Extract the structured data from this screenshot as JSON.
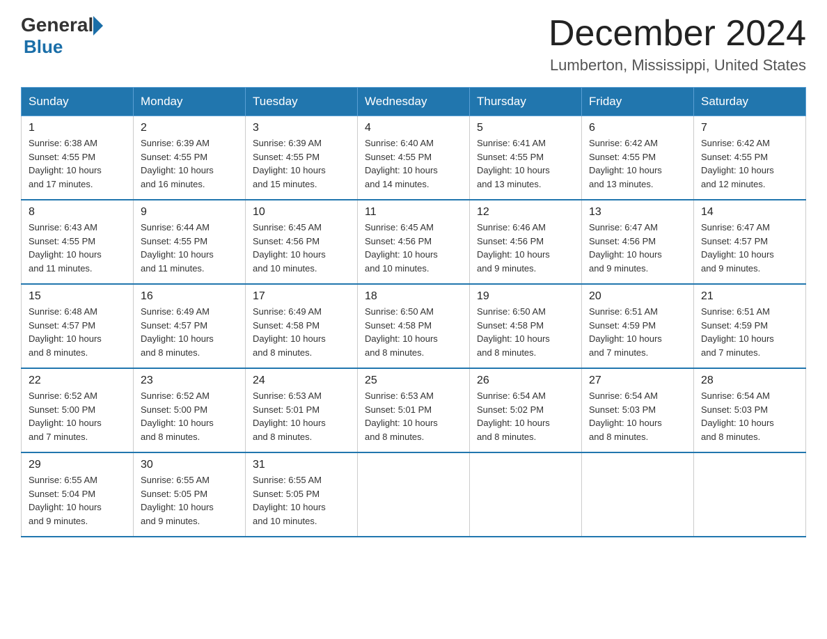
{
  "logo": {
    "general": "General",
    "blue": "Blue"
  },
  "title": "December 2024",
  "location": "Lumberton, Mississippi, United States",
  "days_of_week": [
    "Sunday",
    "Monday",
    "Tuesday",
    "Wednesday",
    "Thursday",
    "Friday",
    "Saturday"
  ],
  "weeks": [
    [
      {
        "day": "1",
        "sunrise": "6:38 AM",
        "sunset": "4:55 PM",
        "daylight": "10 hours and 17 minutes."
      },
      {
        "day": "2",
        "sunrise": "6:39 AM",
        "sunset": "4:55 PM",
        "daylight": "10 hours and 16 minutes."
      },
      {
        "day": "3",
        "sunrise": "6:39 AM",
        "sunset": "4:55 PM",
        "daylight": "10 hours and 15 minutes."
      },
      {
        "day": "4",
        "sunrise": "6:40 AM",
        "sunset": "4:55 PM",
        "daylight": "10 hours and 14 minutes."
      },
      {
        "day": "5",
        "sunrise": "6:41 AM",
        "sunset": "4:55 PM",
        "daylight": "10 hours and 13 minutes."
      },
      {
        "day": "6",
        "sunrise": "6:42 AM",
        "sunset": "4:55 PM",
        "daylight": "10 hours and 13 minutes."
      },
      {
        "day": "7",
        "sunrise": "6:42 AM",
        "sunset": "4:55 PM",
        "daylight": "10 hours and 12 minutes."
      }
    ],
    [
      {
        "day": "8",
        "sunrise": "6:43 AM",
        "sunset": "4:55 PM",
        "daylight": "10 hours and 11 minutes."
      },
      {
        "day": "9",
        "sunrise": "6:44 AM",
        "sunset": "4:55 PM",
        "daylight": "10 hours and 11 minutes."
      },
      {
        "day": "10",
        "sunrise": "6:45 AM",
        "sunset": "4:56 PM",
        "daylight": "10 hours and 10 minutes."
      },
      {
        "day": "11",
        "sunrise": "6:45 AM",
        "sunset": "4:56 PM",
        "daylight": "10 hours and 10 minutes."
      },
      {
        "day": "12",
        "sunrise": "6:46 AM",
        "sunset": "4:56 PM",
        "daylight": "10 hours and 9 minutes."
      },
      {
        "day": "13",
        "sunrise": "6:47 AM",
        "sunset": "4:56 PM",
        "daylight": "10 hours and 9 minutes."
      },
      {
        "day": "14",
        "sunrise": "6:47 AM",
        "sunset": "4:57 PM",
        "daylight": "10 hours and 9 minutes."
      }
    ],
    [
      {
        "day": "15",
        "sunrise": "6:48 AM",
        "sunset": "4:57 PM",
        "daylight": "10 hours and 8 minutes."
      },
      {
        "day": "16",
        "sunrise": "6:49 AM",
        "sunset": "4:57 PM",
        "daylight": "10 hours and 8 minutes."
      },
      {
        "day": "17",
        "sunrise": "6:49 AM",
        "sunset": "4:58 PM",
        "daylight": "10 hours and 8 minutes."
      },
      {
        "day": "18",
        "sunrise": "6:50 AM",
        "sunset": "4:58 PM",
        "daylight": "10 hours and 8 minutes."
      },
      {
        "day": "19",
        "sunrise": "6:50 AM",
        "sunset": "4:58 PM",
        "daylight": "10 hours and 8 minutes."
      },
      {
        "day": "20",
        "sunrise": "6:51 AM",
        "sunset": "4:59 PM",
        "daylight": "10 hours and 7 minutes."
      },
      {
        "day": "21",
        "sunrise": "6:51 AM",
        "sunset": "4:59 PM",
        "daylight": "10 hours and 7 minutes."
      }
    ],
    [
      {
        "day": "22",
        "sunrise": "6:52 AM",
        "sunset": "5:00 PM",
        "daylight": "10 hours and 7 minutes."
      },
      {
        "day": "23",
        "sunrise": "6:52 AM",
        "sunset": "5:00 PM",
        "daylight": "10 hours and 8 minutes."
      },
      {
        "day": "24",
        "sunrise": "6:53 AM",
        "sunset": "5:01 PM",
        "daylight": "10 hours and 8 minutes."
      },
      {
        "day": "25",
        "sunrise": "6:53 AM",
        "sunset": "5:01 PM",
        "daylight": "10 hours and 8 minutes."
      },
      {
        "day": "26",
        "sunrise": "6:54 AM",
        "sunset": "5:02 PM",
        "daylight": "10 hours and 8 minutes."
      },
      {
        "day": "27",
        "sunrise": "6:54 AM",
        "sunset": "5:03 PM",
        "daylight": "10 hours and 8 minutes."
      },
      {
        "day": "28",
        "sunrise": "6:54 AM",
        "sunset": "5:03 PM",
        "daylight": "10 hours and 8 minutes."
      }
    ],
    [
      {
        "day": "29",
        "sunrise": "6:55 AM",
        "sunset": "5:04 PM",
        "daylight": "10 hours and 9 minutes."
      },
      {
        "day": "30",
        "sunrise": "6:55 AM",
        "sunset": "5:05 PM",
        "daylight": "10 hours and 9 minutes."
      },
      {
        "day": "31",
        "sunrise": "6:55 AM",
        "sunset": "5:05 PM",
        "daylight": "10 hours and 10 minutes."
      },
      null,
      null,
      null,
      null
    ]
  ],
  "labels": {
    "sunrise": "Sunrise:",
    "sunset": "Sunset:",
    "daylight": "Daylight:"
  }
}
